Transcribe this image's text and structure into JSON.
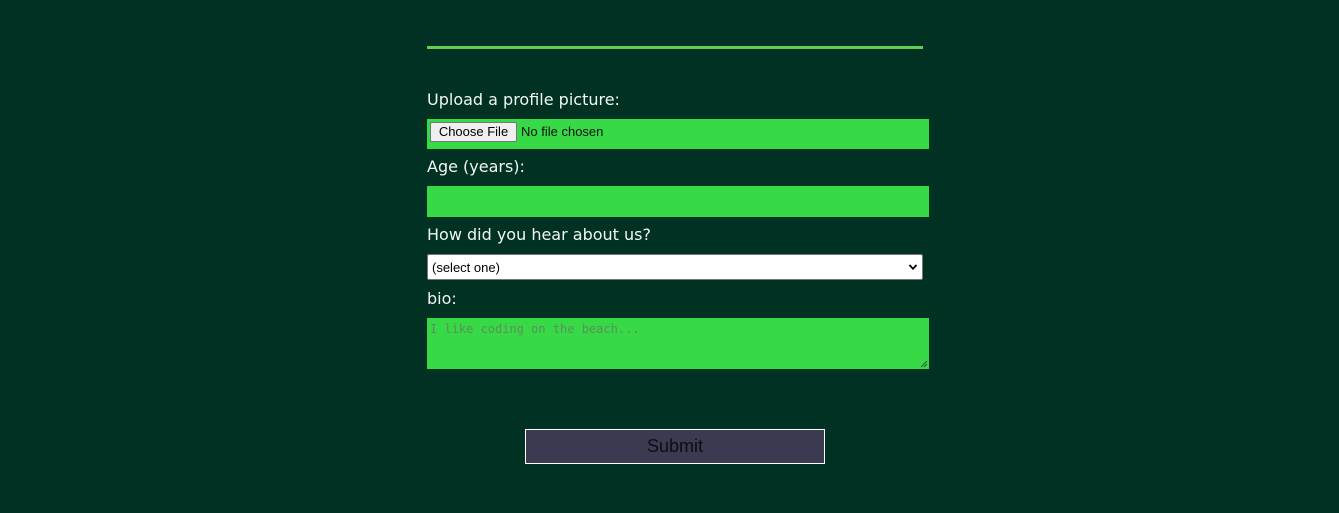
{
  "form": {
    "upload_label": "Upload a profile picture:",
    "file_button_label": "Choose File",
    "file_status": "No file chosen",
    "age_label": "Age (years):",
    "age_value": "",
    "heard_label": "How did you hear about us?",
    "heard_selected": "(select one)",
    "bio_label": "bio:",
    "bio_placeholder": "I like coding on the beach...",
    "submit_label": "Submit"
  },
  "colors": {
    "background": "#003122",
    "field_fill": "#38d946",
    "divider": "#5fce55",
    "submit_fill": "#3a3a50"
  },
  "icons": {
    "select_chevron": "chevron-down-icon",
    "textarea_resize": "resize-handle-icon"
  }
}
